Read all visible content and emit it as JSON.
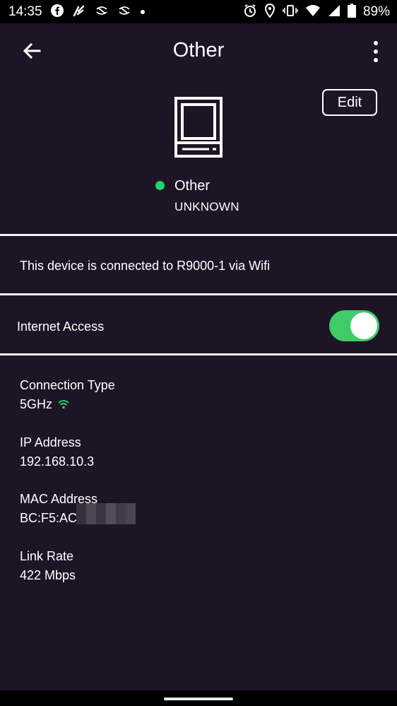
{
  "status_bar": {
    "time": "14:35",
    "battery": "89%"
  },
  "app_bar": {
    "title": "Other",
    "edit_label": "Edit"
  },
  "device": {
    "name": "Other",
    "type": "UNKNOWN",
    "status_color": "#1fd36e"
  },
  "connection_message": "This device is connected to R9000-1 via Wifi",
  "internet_access": {
    "label": "Internet Access",
    "enabled": true,
    "toggle_color": "#3fcc67"
  },
  "details": {
    "connection_type_label": "Connection Type",
    "connection_type_value": "5GHz",
    "ip_label": "IP Address",
    "ip_value": "192.168.10.3",
    "mac_label": "MAC Address",
    "mac_value": "BC:F5:AC",
    "link_rate_label": "Link Rate",
    "link_rate_value": "422 Mbps"
  },
  "colors": {
    "background": "#1d1426",
    "accent_green": "#1fd36e"
  }
}
